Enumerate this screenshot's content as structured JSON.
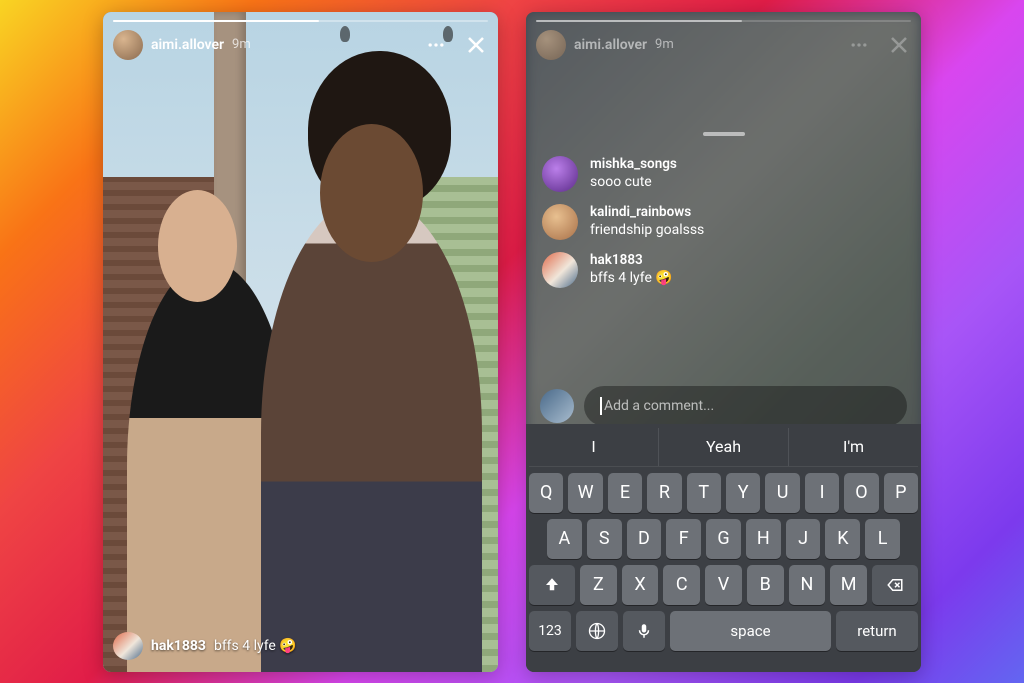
{
  "left": {
    "username": "aimi.allover",
    "timestamp": "9m",
    "bottom_comment": {
      "user": "hak1883",
      "text": "bffs 4 lyfe 🤪"
    }
  },
  "right": {
    "username": "aimi.allover",
    "timestamp": "9m",
    "comments": [
      {
        "user": "mishka_songs",
        "text": "sooo cute"
      },
      {
        "user": "kalindi_rainbows",
        "text": "friendship goalsss"
      },
      {
        "user": "hak1883",
        "text": "bffs 4 lyfe 🤪"
      }
    ],
    "input_placeholder": "Add a comment..."
  },
  "keyboard": {
    "predictions": [
      "I",
      "Yeah",
      "I'm"
    ],
    "row1": [
      "Q",
      "W",
      "E",
      "R",
      "T",
      "Y",
      "U",
      "I",
      "O",
      "P"
    ],
    "row2": [
      "A",
      "S",
      "D",
      "F",
      "G",
      "H",
      "J",
      "K",
      "L"
    ],
    "row3": [
      "Z",
      "X",
      "C",
      "V",
      "B",
      "N",
      "M"
    ],
    "bottom": {
      "num": "123",
      "space": "space",
      "return": "return"
    }
  }
}
